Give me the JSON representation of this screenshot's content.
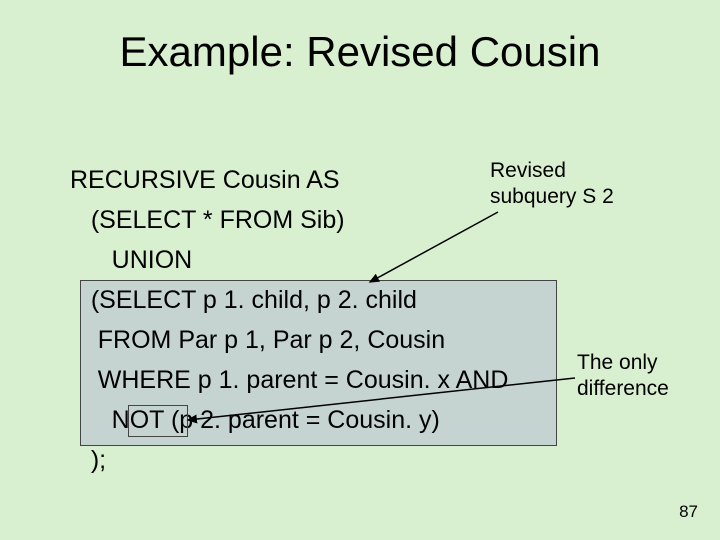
{
  "title": "Example: Revised Cousin",
  "code": {
    "l1": "RECURSIVE Cousin AS",
    "l2": "   (SELECT * FROM Sib)",
    "l3": "      UNION",
    "l4": "   (SELECT p 1. child, p 2. child",
    "l5": "    FROM Par p 1, Par p 2, Cousin",
    "l6": "    WHERE p 1. parent = Cousin. x AND",
    "l7": "      NOT (p 2. parent = Cousin. y)",
    "l8": "   );"
  },
  "annot": {
    "revised_l1": "Revised",
    "revised_l2": "subquery S 2",
    "diff_l1": "The only",
    "diff_l2": "difference"
  },
  "slide_number": "87"
}
